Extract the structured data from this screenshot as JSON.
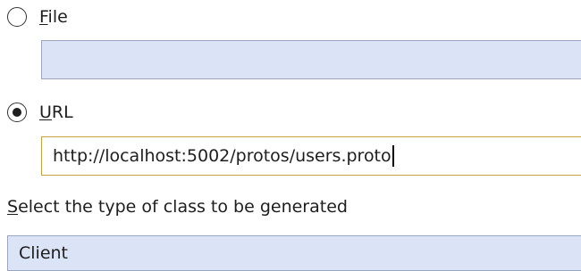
{
  "source": {
    "file_option": {
      "mnemonic": "F",
      "rest": "ile",
      "checked": false
    },
    "file_path": {
      "value": ""
    },
    "url_option": {
      "mnemonic": "U",
      "rest": "RL",
      "checked": true
    },
    "url_input": {
      "value": "http://localhost:5002/protos/users.proto"
    }
  },
  "class_type": {
    "label_mnemonic": "S",
    "label_rest": "elect the type of class to be generated",
    "selected": "Client"
  },
  "colors": {
    "field_background": "#dbe4f6",
    "field_border": "#9aa6bc",
    "focus_border": "#c8a040"
  }
}
